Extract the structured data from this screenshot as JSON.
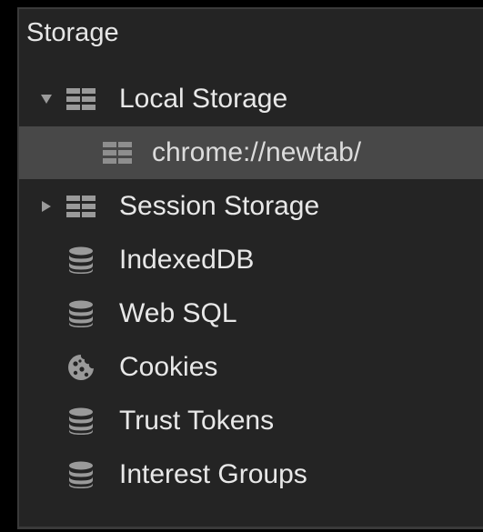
{
  "panel": {
    "title": "Storage"
  },
  "items": [
    {
      "label": "Local Storage",
      "icon": "table-grid-icon",
      "expanded": true
    },
    {
      "label": "chrome://newtab/",
      "icon": "table-grid-icon",
      "selected": true
    },
    {
      "label": "Session Storage",
      "icon": "table-grid-icon",
      "expanded": false
    },
    {
      "label": "IndexedDB",
      "icon": "database-icon"
    },
    {
      "label": "Web SQL",
      "icon": "database-icon"
    },
    {
      "label": "Cookies",
      "icon": "cookie-icon"
    },
    {
      "label": "Trust Tokens",
      "icon": "database-icon"
    },
    {
      "label": "Interest Groups",
      "icon": "database-icon"
    }
  ],
  "colors": {
    "background": "#242424",
    "selected_row": "#484848",
    "text": "#e8e8e8",
    "icon": "#9a9a9a"
  }
}
